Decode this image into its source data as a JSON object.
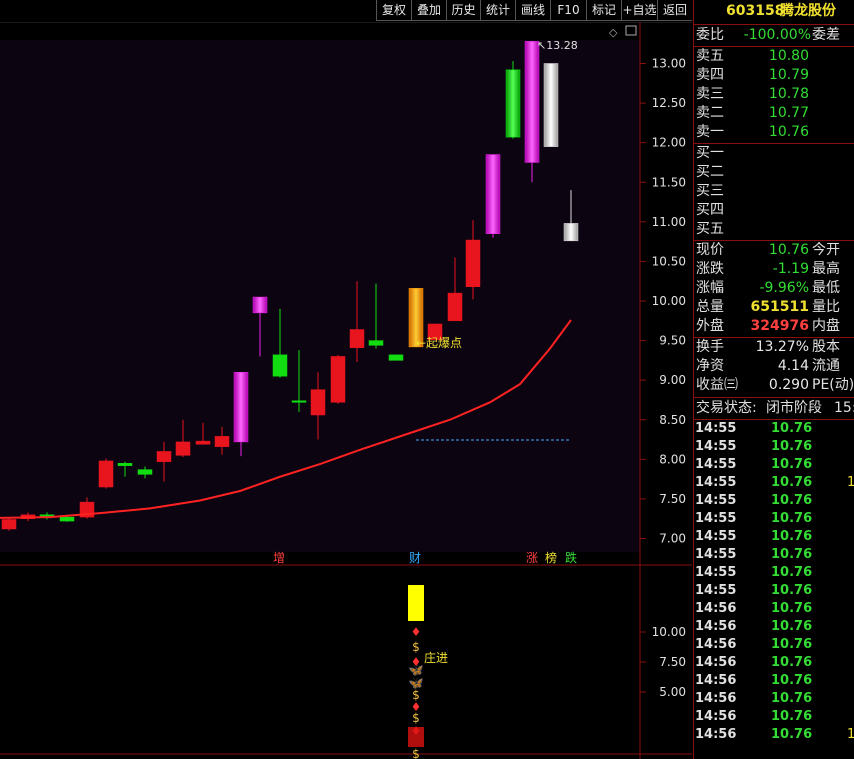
{
  "toolbar": {
    "buttons": [
      "复权",
      "叠加",
      "历史",
      "统计",
      "画线",
      "F10",
      "标记",
      "+自选",
      "返回"
    ]
  },
  "stock": {
    "code": "603158",
    "name": "腾龙股份"
  },
  "order_book": {
    "weibi_label": "委比",
    "weibi_value": "-100.00%",
    "weicha_label": "委差",
    "asks": [
      {
        "label": "卖五",
        "price": "10.80"
      },
      {
        "label": "卖四",
        "price": "10.79"
      },
      {
        "label": "卖三",
        "price": "10.78"
      },
      {
        "label": "卖二",
        "price": "10.77"
      },
      {
        "label": "卖一",
        "price": "10.76"
      }
    ],
    "bids": [
      {
        "label": "买一",
        "price": ""
      },
      {
        "label": "买二",
        "price": ""
      },
      {
        "label": "买三",
        "price": ""
      },
      {
        "label": "买四",
        "price": ""
      },
      {
        "label": "买五",
        "price": ""
      }
    ]
  },
  "quote": {
    "rows": [
      {
        "l1": "现价",
        "v1": "10.76",
        "l2": "今开"
      },
      {
        "l1": "涨跌",
        "v1": "-1.19",
        "l2": "最高"
      },
      {
        "l1": "涨幅",
        "v1": "-9.96%",
        "l2": "最低"
      },
      {
        "l1": "总量",
        "v1": "651511",
        "l2": "量比"
      },
      {
        "l1": "外盘",
        "v1": "324976",
        "l2": "内盘"
      }
    ]
  },
  "fundamentals": {
    "rows": [
      {
        "l1": "换手",
        "v1": "13.27%",
        "l2": "股本"
      },
      {
        "l1": "净资",
        "v1": "4.14",
        "l2": "流通"
      },
      {
        "l1": "收益㈢",
        "v1": "0.290",
        "l2": "PE(动)"
      }
    ]
  },
  "trade_status": {
    "label": "交易状态:",
    "value": "闭市阶段",
    "extra": "15:"
  },
  "ticks": [
    {
      "t": "14:55",
      "p": "10.76",
      "x": ""
    },
    {
      "t": "14:55",
      "p": "10.76",
      "x": ""
    },
    {
      "t": "14:55",
      "p": "10.76",
      "x": ""
    },
    {
      "t": "14:55",
      "p": "10.76",
      "x": "1"
    },
    {
      "t": "14:55",
      "p": "10.76",
      "x": ""
    },
    {
      "t": "14:55",
      "p": "10.76",
      "x": ""
    },
    {
      "t": "14:55",
      "p": "10.76",
      "x": ""
    },
    {
      "t": "14:55",
      "p": "10.76",
      "x": ""
    },
    {
      "t": "14:55",
      "p": "10.76",
      "x": ""
    },
    {
      "t": "14:55",
      "p": "10.76",
      "x": ""
    },
    {
      "t": "14:56",
      "p": "10.76",
      "x": ""
    },
    {
      "t": "14:56",
      "p": "10.76",
      "x": ""
    },
    {
      "t": "14:56",
      "p": "10.76",
      "x": ""
    },
    {
      "t": "14:56",
      "p": "10.76",
      "x": ""
    },
    {
      "t": "14:56",
      "p": "10.76",
      "x": ""
    },
    {
      "t": "14:56",
      "p": "10.76",
      "x": ""
    },
    {
      "t": "14:56",
      "p": "10.76",
      "x": ""
    },
    {
      "t": "14:56",
      "p": "10.76",
      "x": "1"
    }
  ],
  "main_chart": {
    "y_ticks": [
      "13.00",
      "12.50",
      "12.00",
      "11.50",
      "11.00",
      "10.50",
      "10.00",
      "9.50",
      "9.00",
      "8.50",
      "8.00",
      "7.50",
      "7.00"
    ],
    "high_label": "13.28",
    "annotation": "←起爆点",
    "markers": [
      {
        "text": "增",
        "color": "#ff4040"
      },
      {
        "text": "财",
        "color": "#33aaff"
      },
      {
        "text": "涨",
        "color": "#ff4040"
      },
      {
        "text": "榜",
        "color": "#f0e030"
      },
      {
        "text": "跌",
        "color": "#33dd33"
      }
    ]
  },
  "sub_chart": {
    "y_ticks": [
      "10.00",
      "7.50",
      "5.00"
    ],
    "label": "庄进"
  },
  "colors": {
    "up": "#e8141e",
    "down": "#11dd11",
    "magenta": "#ee22ee",
    "ma": "#ff2222",
    "bg_main": "#0c0410",
    "grid": "#8a1010"
  }
}
